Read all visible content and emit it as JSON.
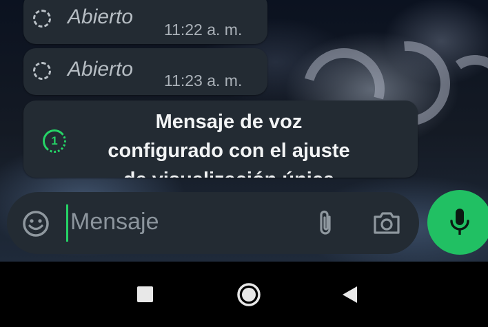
{
  "messages": [
    {
      "status_label": "Abierto",
      "time": "11:22 a. m."
    },
    {
      "status_label": "Abierto",
      "time": "11:23 a. m."
    }
  ],
  "voice_message": {
    "icon_label": "1",
    "text_line1": "Mensaje de voz",
    "text_line2": "configurado con el ajuste",
    "text_line3": "de visualización única"
  },
  "composer": {
    "placeholder": "Mensaje",
    "emoji_icon": "emoji-icon",
    "attach_icon": "paperclip-icon",
    "camera_icon": "camera-icon",
    "mic_icon": "microphone-icon"
  },
  "navigation": {
    "recents_icon": "square-icon",
    "home_icon": "circle-icon",
    "back_icon": "triangle-back-icon"
  },
  "colors": {
    "accent": "#25d366",
    "bubble": "#232b33",
    "mic_button": "#21c063"
  }
}
